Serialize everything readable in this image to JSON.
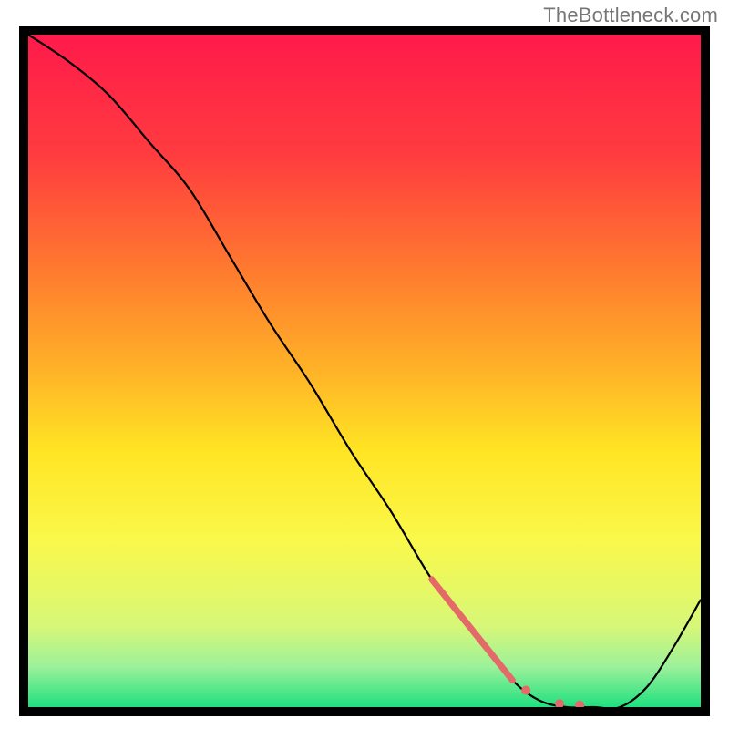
{
  "watermark": "TheBottleneck.com",
  "chart_data": {
    "type": "line",
    "title": "",
    "xlabel": "",
    "ylabel": "",
    "xlim": [
      0,
      100
    ],
    "ylim": [
      0,
      100
    ],
    "grid": false,
    "background_gradient": {
      "stops": [
        {
          "pos": 0.0,
          "color": "#ff1a4b"
        },
        {
          "pos": 0.18,
          "color": "#ff3c3f"
        },
        {
          "pos": 0.35,
          "color": "#ff7a2f"
        },
        {
          "pos": 0.5,
          "color": "#ffb327"
        },
        {
          "pos": 0.62,
          "color": "#ffe524"
        },
        {
          "pos": 0.75,
          "color": "#faf84a"
        },
        {
          "pos": 0.88,
          "color": "#d7f778"
        },
        {
          "pos": 0.94,
          "color": "#9cf19a"
        },
        {
          "pos": 1.0,
          "color": "#1fe07f"
        }
      ]
    },
    "curve": {
      "x": [
        0,
        6,
        12,
        18,
        24,
        30,
        36,
        42,
        48,
        54,
        60,
        66,
        72,
        76,
        80,
        84,
        88,
        92,
        96,
        100
      ],
      "y": [
        100,
        96,
        91,
        84,
        77,
        67,
        57,
        48,
        38,
        29,
        19,
        11,
        4,
        1,
        0,
        0,
        0,
        3,
        9,
        16
      ]
    },
    "markers": {
      "segment": {
        "x": [
          60,
          72
        ],
        "y": [
          19,
          4
        ],
        "color": "#e46a6a",
        "width": 7
      },
      "dots": [
        {
          "x": 74,
          "y": 2.5,
          "r": 5,
          "color": "#e46a6a"
        },
        {
          "x": 79,
          "y": 0.5,
          "r": 5,
          "color": "#e46a6a"
        },
        {
          "x": 82,
          "y": 0.3,
          "r": 5,
          "color": "#e46a6a"
        }
      ]
    }
  }
}
